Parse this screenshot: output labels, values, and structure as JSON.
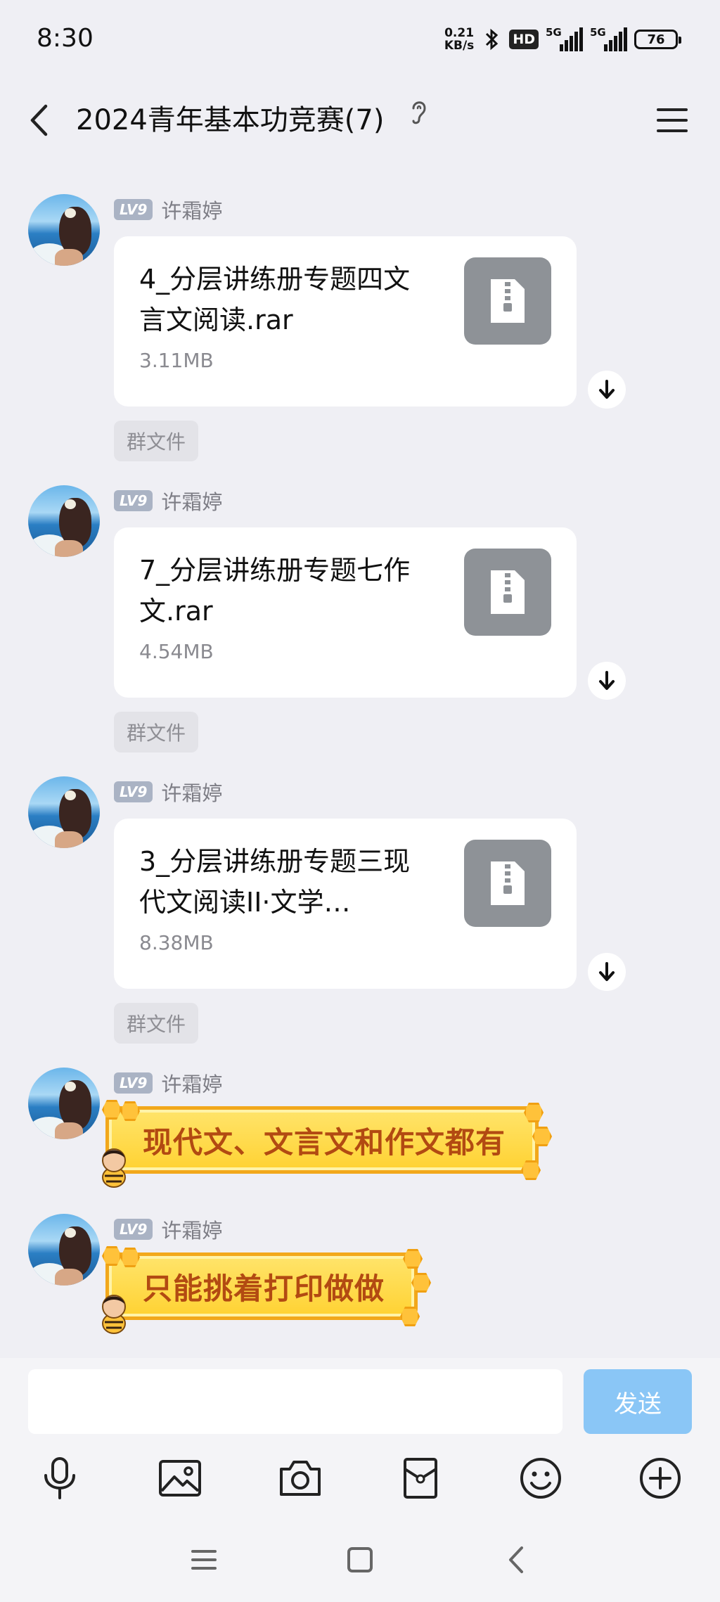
{
  "status_bar": {
    "time": "8:30",
    "net_speed_value": "0.21",
    "net_speed_unit": "KB/s",
    "hd_label": "HD",
    "sim1_label": "5G",
    "sim2_label": "5G",
    "battery": "76"
  },
  "header": {
    "title": "2024青年基本功竞赛(7)"
  },
  "messages": [
    {
      "level": "LV9",
      "sender": "许霜婷",
      "file_name": "4_分层讲练册专题四文言文阅读.rar",
      "file_size": "3.11MB",
      "tag": "群文件"
    },
    {
      "level": "LV9",
      "sender": "许霜婷",
      "file_name": "7_分层讲练册专题七作文.rar",
      "file_size": "4.54MB",
      "tag": "群文件"
    },
    {
      "level": "LV9",
      "sender": "许霜婷",
      "file_name": "3_分层讲练册专题三现代文阅读II·文学…",
      "file_size": "8.38MB",
      "tag": "群文件"
    },
    {
      "level": "LV9",
      "sender": "许霜婷",
      "text": "现代文、文言文和作文都有"
    },
    {
      "level": "LV9",
      "sender": "许霜婷",
      "text": "只能挑着打印做做"
    }
  ],
  "input": {
    "value": "",
    "send_label": "发送"
  },
  "toolbar_icons": [
    "microphone-icon",
    "image-icon",
    "camera-icon",
    "red-packet-icon",
    "emoji-icon",
    "plus-icon"
  ],
  "colors": {
    "background": "#efeff4",
    "send_button": "#8ac6f6",
    "sticker_fill": "#ffd232",
    "sticker_text": "#b24a12"
  }
}
